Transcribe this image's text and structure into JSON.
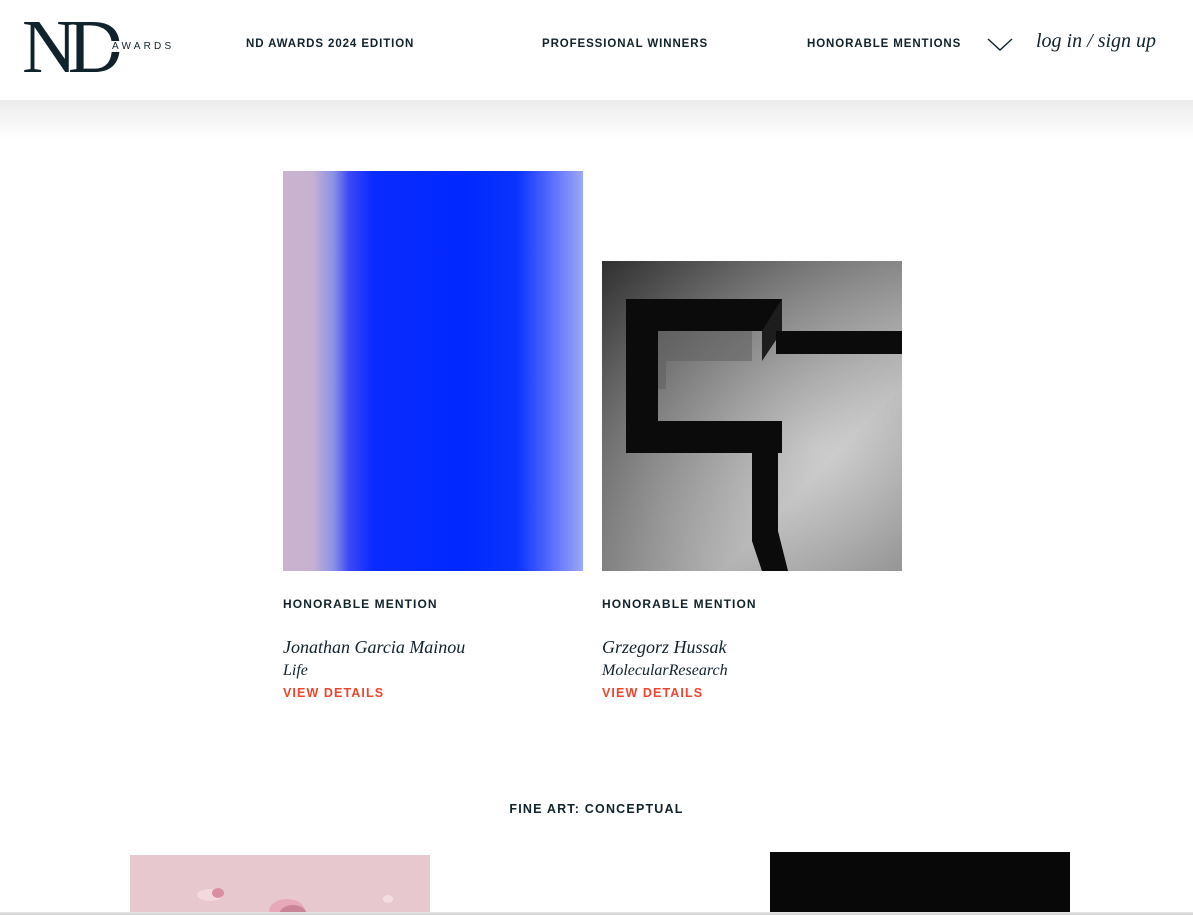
{
  "brand": {
    "logo_letters": "ND",
    "logo_word": "AWARDS"
  },
  "nav": {
    "items": [
      {
        "label": "ND AWARDS 2024 EDITION"
      },
      {
        "label": "PROFESSIONAL WINNERS"
      },
      {
        "label": "HONORABLE MENTIONS"
      }
    ],
    "dropdown_icon": "chevron-down-icon",
    "login_label": "log in",
    "separator": " / ",
    "signup_label": "sign up"
  },
  "entries": [
    {
      "badge": "HONORABLE MENTION",
      "author": "Jonathan Garcia Mainou",
      "title": "Life",
      "cta": "VIEW DETAILS"
    },
    {
      "badge": "HONORABLE MENTION",
      "author": "Grzegorz Hussak",
      "title": "MolecularResearch",
      "cta": "VIEW DETAILS"
    }
  ],
  "section": {
    "title": "FINE ART: CONCEPTUAL"
  },
  "colors": {
    "text": "#10222b",
    "accent": "#f0452d",
    "background": "#ffffff"
  }
}
